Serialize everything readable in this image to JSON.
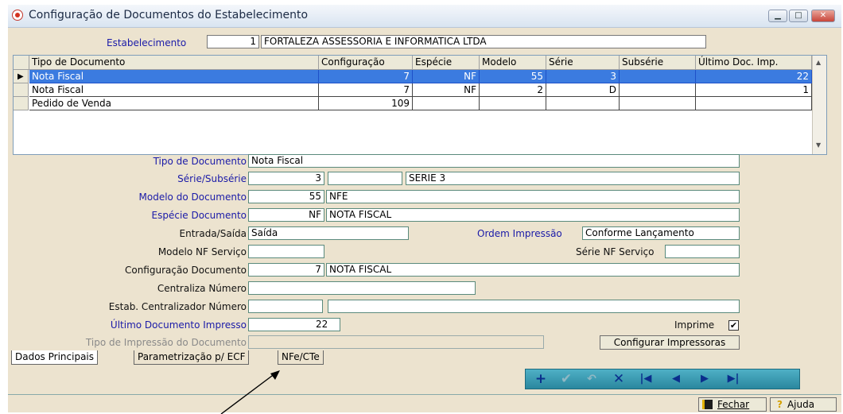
{
  "window": {
    "title": "Configuração de Documentos do Estabelecimento"
  },
  "estab": {
    "label": "Estabelecimento",
    "code": "1",
    "name": "FORTALEZA ASSESSORIA E INFORMATICA LTDA"
  },
  "grid": {
    "headers": [
      "Tipo de Documento",
      "Configuração",
      "Espécie",
      "Modelo",
      "Série",
      "Subsérie",
      "Último Doc. Imp."
    ],
    "rows": [
      [
        "Nota Fiscal",
        "7",
        "NF",
        "55",
        "3",
        "",
        "22"
      ],
      [
        "Nota Fiscal",
        "7",
        "NF",
        "2",
        "D",
        "",
        "1"
      ],
      [
        "Pedido de Venda",
        "109",
        "",
        "",
        "",
        "",
        ""
      ]
    ]
  },
  "form": {
    "tipo_doc_label": "Tipo de Documento",
    "tipo_doc": "Nota Fiscal",
    "serie_label": "Série/Subsérie",
    "serie": "3",
    "subserie": "",
    "serie_desc": "SERIE 3",
    "modelo_label": "Modelo do Documento",
    "modelo": "55",
    "modelo_desc": "NFE",
    "especie_label": "Espécie Documento",
    "especie": "NF",
    "especie_desc": "NOTA FISCAL",
    "entrada_label": "Entrada/Saída",
    "entrada": "Saída",
    "ordem_label": "Ordem Impressão",
    "ordem": "Conforme Lançamento",
    "modelo_nf_label": "Modelo NF Serviço",
    "modelo_nf": "",
    "serie_nf_label": "Série NF Serviço",
    "serie_nf": "",
    "config_label": "Configuração Documento",
    "config": "7",
    "config_desc": "NOTA FISCAL",
    "centraliza_label": "Centraliza Número",
    "centraliza": "",
    "estab_cent_label": "Estab. Centralizador Número",
    "estab_cent": "",
    "estab_cent_desc": "",
    "ultimo_label": "Último Documento Impresso",
    "ultimo": "22",
    "imprime_label": "Imprime",
    "tipo_imp_label": "Tipo de Impressão do Documento",
    "tipo_imp": "",
    "config_imp_button": "Configurar Impressoras"
  },
  "tabs": [
    "Dados Principais",
    "Parametrização p/ ECF",
    "NFe/CTe"
  ],
  "buttons": {
    "fechar": "Fechar",
    "ajuda": "Ajuda"
  }
}
